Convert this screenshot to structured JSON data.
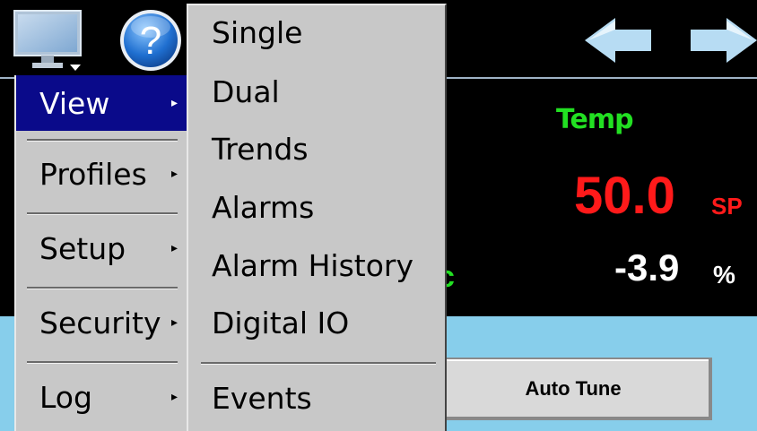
{
  "menu": {
    "items": [
      {
        "label": "View",
        "selected": true
      },
      {
        "label": "Profiles",
        "selected": false
      },
      {
        "label": "Setup",
        "selected": false
      },
      {
        "label": "Security",
        "selected": false
      },
      {
        "label": "Log",
        "selected": false
      }
    ],
    "arrow_glyph": "▸"
  },
  "submenu": {
    "items": [
      {
        "label": "Single"
      },
      {
        "label": "Dual"
      },
      {
        "label": "Trends"
      },
      {
        "label": "Alarms"
      },
      {
        "label": "Alarm History"
      },
      {
        "label": "Digital IO"
      },
      {
        "label": "Events"
      }
    ]
  },
  "display": {
    "loop_name": "Temp",
    "process_value": "50.0",
    "process_unit": "SP",
    "output_value": "-3.9",
    "output_unit": "%",
    "partial_char": "c",
    "partial_colon": ":"
  },
  "bottom": {
    "auto_tune_label": "Auto Tune"
  },
  "icons": {
    "monitor": "monitor-icon",
    "help": "help-icon",
    "back": "arrow-left-icon",
    "forward": "arrow-right-icon"
  },
  "colors": {
    "background": "#000000",
    "menu_bg": "#c8c8c8",
    "menu_selected": "#0a0a8a",
    "bottom_bg": "#87ceeb",
    "loop_name": "#22e022",
    "process_value": "#ff1a1a",
    "output_value": "#ffffff",
    "arrow_fill": "#b7dcf3"
  }
}
